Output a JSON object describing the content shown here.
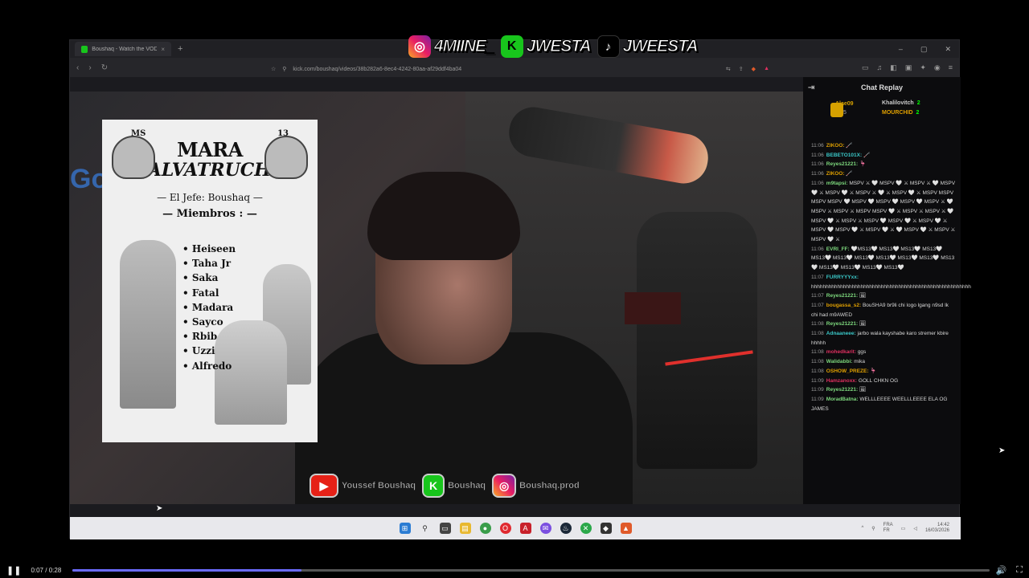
{
  "overlay_top": {
    "instagram_handle": "4MIINE_",
    "kick_handle": "JWESTA",
    "tiktok_handle": "JWEESTA"
  },
  "browser": {
    "tab_title": "Boushaq - Watch the VOD on Kick",
    "tab_close": "×",
    "new_tab": "+",
    "window_controls": [
      "–",
      "▢",
      "✕"
    ],
    "url": "kick.com/boushaq/videos/38b282a6-8ec4-4242-80aa-af29ddf4ba04"
  },
  "poster": {
    "left_number": "MS",
    "right_number": "13",
    "title_line1": "MARA",
    "title_line2": "SALVATRUCHA",
    "jefe_line": "— El Jefe: Boushaq —",
    "members_heading": "— Miembros : —",
    "members": [
      "Heiseen",
      "Taha Jr",
      "Saka",
      "Fatal",
      "Madara",
      "Sayco",
      "Rbib",
      "Uzzi",
      "Alfredo"
    ]
  },
  "overlay_bottom": {
    "youtube_name": "Youssef Boushaq",
    "kick_name": "Boushaq",
    "instagram_name": "Boushaq.prod"
  },
  "chat": {
    "title": "Chat Replay",
    "leaderboard": [
      {
        "name": "Alae09",
        "count": "5"
      },
      {
        "name": "Khalilovitch",
        "count": "2"
      },
      {
        "name": "MOURCHID",
        "count": "2"
      }
    ],
    "messages": [
      {
        "time": "11:06",
        "user": "ZIKOO:",
        "text": "🦯",
        "color": "#e0a000"
      },
      {
        "time": "11:06",
        "user": "BEBETO101X:",
        "text": "🦯",
        "color": "#3ac8c8"
      },
      {
        "time": "11:06",
        "user": "Reyes21221:",
        "text": "🦩",
        "color": "#7dd87d"
      },
      {
        "time": "11:06",
        "user": "ZIKOO:",
        "text": "🦯",
        "color": "#e0a000"
      },
      {
        "time": "11:06",
        "user": "m9tapsi:",
        "text": "MSPV ⚔ 🤍 MSPV 🤍 ⚔ MSPV ⚔ 🤍 MSPV 🤍 ⚔ MSPV 🤍 ⚔ MSPV ⚔ 🤍 ⚔ MSPV 🤍 ⚔ MSPV MSPV MSPV MSPV 🤍 MSPV 🤍 MSPV 🤍 MSPV 🤍 MSPV ⚔ 🤍 MSPV ⚔ MSPV ⚔ MSPV MSPV 🤍 ⚔ MSPV ⚔ MSPV ⚔ 🤍 MSPV 🤍 ⚔ MSPV ⚔ MSPV 🤍 MSPV 🤍 ⚔ MSPV 🤍 ⚔ MSPV 🤍 MSPV 🤍 ⚔ MSPV 🤍 ⚔ 🤍 MSPV 🤍 ⚔ MSPV ⚔ MSPV 🤍 ⚔",
        "color": "#7dd87d"
      },
      {
        "time": "11:06",
        "user": "EVRI_FF:",
        "text": "🤍MS13🤍 MS13🤍 MS13🤍 MS13🤍 MS13🤍 MS13🤍 MS13🤍 MS13🤍 MS13🤍 MS13🤍 MS13🤍 MS13🤍 MS13🤍 MS13🤍 MS13🤍",
        "color": "#7dd87d"
      },
      {
        "time": "11:07",
        "user": "FURRYYYxx:",
        "text": "hhhhhhhhhhhhhhhhhhhhhhhhhhhhhhhhhhhhhhhhhhhhhhhhhhhhhhh",
        "color": "#3ac8c8"
      },
      {
        "time": "11:07",
        "user": "Reyes21221:",
        "text": "🖼",
        "color": "#7dd87d"
      },
      {
        "time": "11:07",
        "user": "bougassa_s2:",
        "text": "BouSHA9 br9li chi logo lgang n9sd lk chi had m9AWED",
        "color": "#e0a000"
      },
      {
        "time": "11:08",
        "user": "Reyes21221:",
        "text": "🖼",
        "color": "#7dd87d"
      },
      {
        "time": "11:08",
        "user": "Adnaaneee:",
        "text": "jarbo wala kayshabe karo stremer kbire hhhhh",
        "color": "#3ac8c8"
      },
      {
        "time": "11:08",
        "user": "mohedkarit:",
        "text": "ggs",
        "color": "#e03060"
      },
      {
        "time": "11:08",
        "user": "Walidabbi:",
        "text": "mika",
        "color": "#7dd87d"
      },
      {
        "time": "11:08",
        "user": "OSHOW_PREZE:",
        "text": "🦩",
        "color": "#e0a000"
      },
      {
        "time": "11:09",
        "user": "Hamzanoxx:",
        "text": "GOLL CHKN OG",
        "color": "#e03060"
      },
      {
        "time": "11:09",
        "user": "Reyes21221:",
        "text": "🖼",
        "color": "#7dd87d"
      },
      {
        "time": "11:09",
        "user": "MoradBatna:",
        "text": "WELLLEEEE WEELLLEEEE ELA OG JAMES",
        "color": "#7dd87d"
      }
    ]
  },
  "taskbar": {
    "tray_lang": "FRA",
    "tray_region": "FR",
    "clock_time": "14:42",
    "clock_date": "16/03/2026"
  },
  "player": {
    "current_time": "0:07",
    "duration": "0:28",
    "separator": "/",
    "progress_fraction": 0.25
  }
}
